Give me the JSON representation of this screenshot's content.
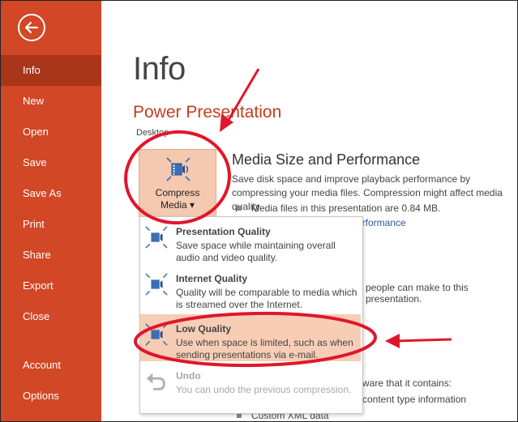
{
  "sidebar": {
    "items": [
      {
        "label": "Info",
        "active": true
      },
      {
        "label": "New"
      },
      {
        "label": "Open"
      },
      {
        "label": "Save"
      },
      {
        "label": "Save As"
      },
      {
        "label": "Print"
      },
      {
        "label": "Share"
      },
      {
        "label": "Export"
      },
      {
        "label": "Close"
      },
      {
        "label": "Account"
      },
      {
        "label": "Options"
      }
    ]
  },
  "main": {
    "page_title": "Info",
    "doc_title": "Power Presentation",
    "doc_location": "Desktop",
    "compress_button": {
      "line1": "Compress",
      "line2": "Media ▾"
    },
    "section": {
      "heading": "Media Size and Performance",
      "description": "Save disk space and improve playback performance by compressing your media files. Compression might affect media quality.",
      "bullet_media": "Media files in this presentation are 0.84 MB.",
      "partial_link": "erformance",
      "partial_people": "people can make to this presentation.",
      "partial_aware": "ware that it contains:",
      "partial_content": "content type information",
      "bullet_xml": "Custom XML data"
    }
  },
  "dropdown": {
    "items": [
      {
        "title": "Presentation Quality",
        "desc": "Save space while maintaining overall audio and video quality."
      },
      {
        "title": "Internet Quality",
        "desc": "Quality will be comparable to media which is streamed over the Internet."
      },
      {
        "title": "Low Quality",
        "desc": "Use when space is limited, such as when sending presentations via e-mail."
      },
      {
        "title": "Undo",
        "desc": "You can undo the previous compression."
      }
    ]
  },
  "colors": {
    "sidebar_bg": "#d24726",
    "sidebar_active": "#a9351b",
    "accent_title": "#c43e1c",
    "highlight": "#f7cdb6",
    "annotation_red": "#e0162b"
  }
}
